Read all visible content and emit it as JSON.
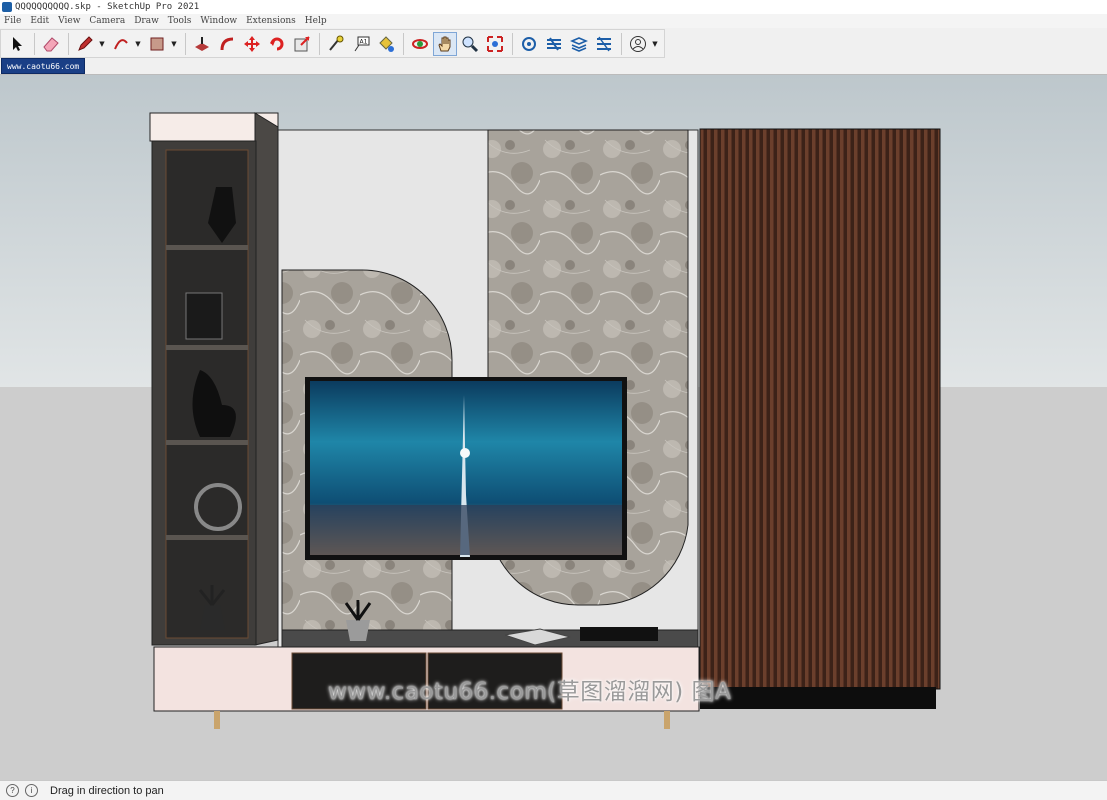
{
  "window": {
    "title": "QQQQQQQQQQ.skp - SketchUp Pro 2021"
  },
  "menu": [
    "File",
    "Edit",
    "View",
    "Camera",
    "Draw",
    "Tools",
    "Window",
    "Extensions",
    "Help"
  ],
  "toolbar": {
    "tools": [
      {
        "name": "select-tool",
        "icon": "arrow-icon"
      },
      {
        "name": "eraser-tool",
        "icon": "eraser-icon"
      },
      {
        "name": "line-tool",
        "icon": "pencil-icon"
      },
      {
        "name": "arc-tool",
        "icon": "arc-icon"
      },
      {
        "name": "rectangle-tool",
        "icon": "rectangle-icon"
      },
      {
        "name": "push-pull-tool",
        "icon": "pushpull-icon"
      },
      {
        "name": "offset-tool",
        "icon": "offset-icon"
      },
      {
        "name": "move-tool",
        "icon": "move-icon"
      },
      {
        "name": "rotate-tool",
        "icon": "rotate-icon"
      },
      {
        "name": "scale-tool",
        "icon": "scale-icon"
      },
      {
        "name": "tape-measure-tool",
        "icon": "tape-icon"
      },
      {
        "name": "text-tool",
        "icon": "text-icon"
      },
      {
        "name": "paint-bucket-tool",
        "icon": "paint-bucket-icon"
      },
      {
        "name": "orbit-tool",
        "icon": "orbit-icon"
      },
      {
        "name": "pan-tool",
        "icon": "hand-icon",
        "active": true
      },
      {
        "name": "zoom-tool",
        "icon": "magnifier-icon"
      },
      {
        "name": "zoom-extents-tool",
        "icon": "zoom-extents-icon"
      },
      {
        "name": "warehouse-tool",
        "icon": "warehouse-icon"
      },
      {
        "name": "extension-warehouse-tool",
        "icon": "extension-icon"
      },
      {
        "name": "layout-tool",
        "icon": "layout-icon"
      },
      {
        "name": "extension-manager-tool",
        "icon": "extension-manager-icon"
      },
      {
        "name": "account-tool",
        "icon": "account-icon"
      }
    ],
    "text_tool_label": "A1"
  },
  "scene_tab": {
    "label": "www.caotu66.com"
  },
  "watermark": {
    "text": "www.caotu66.com(草图溜溜网) 图A"
  },
  "status": {
    "message": "Drag in direction to pan"
  },
  "colors": {
    "sky": "#c3ccd0",
    "ground": "#cdcdcd",
    "accent": "#1a3f86",
    "slats": "#4a2a1e"
  }
}
